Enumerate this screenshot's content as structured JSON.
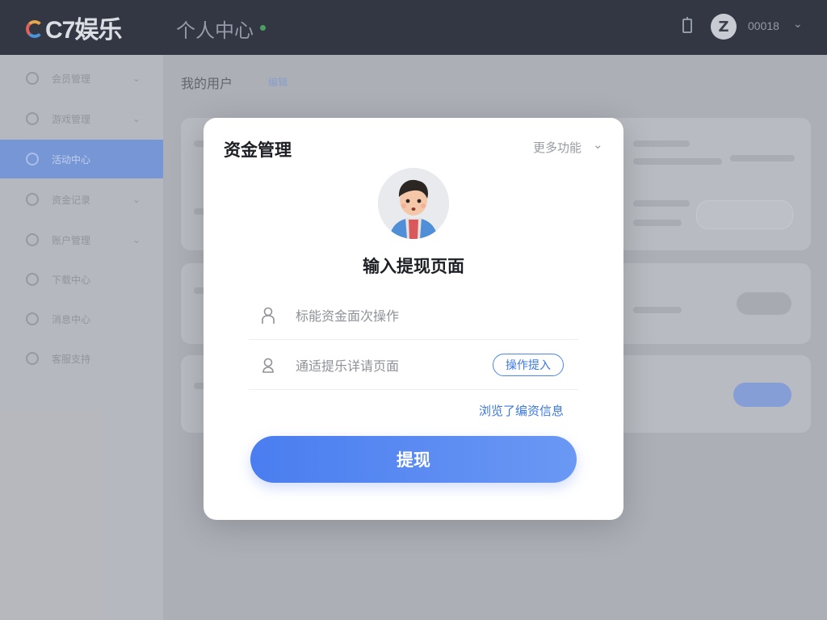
{
  "header": {
    "logo_text": "C7娱乐",
    "title": "个人中心",
    "username": "00018"
  },
  "sidebar": {
    "items": [
      {
        "label": "会员管理"
      },
      {
        "label": "游戏管理"
      },
      {
        "label": "活动中心"
      },
      {
        "label": "资金记录"
      },
      {
        "label": "账户管理"
      },
      {
        "label": "下载中心"
      },
      {
        "label": "消息中心"
      },
      {
        "label": "客服支持"
      }
    ],
    "active_index": 2
  },
  "content": {
    "title": "我的用户",
    "subtitle": "编辑"
  },
  "modal": {
    "title": "资金管理",
    "more_label": "更多功能",
    "heading": "输入提现页面",
    "field1_placeholder": "标能资金面次操作",
    "field2_placeholder": "通适提乐详请页面",
    "op_button": "操作提入",
    "link_label": "浏览了编资信息",
    "submit_label": "提现"
  },
  "colors": {
    "accent": "#4a7df0",
    "header_bg": "#1f2230",
    "active_sidebar": "#6d8fd6"
  }
}
